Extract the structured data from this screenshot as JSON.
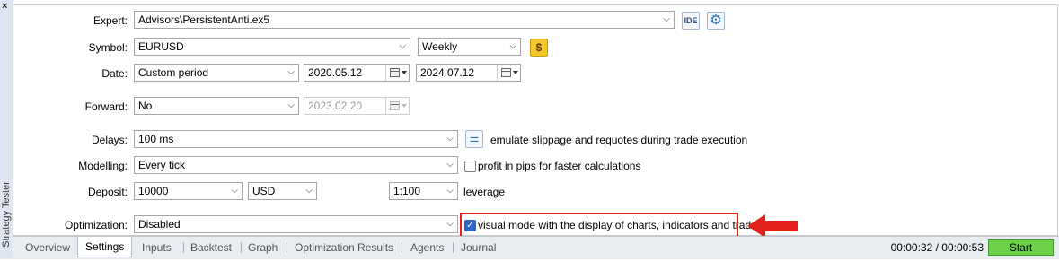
{
  "side_panel": {
    "close": "×",
    "title": "Strategy Tester"
  },
  "expert": {
    "label": "Expert:",
    "value": "Advisors\\PersistentAnti.ex5",
    "ide_label": "IDE",
    "settings_icon": "gear-icon"
  },
  "symbol": {
    "label": "Symbol:",
    "value": "EURUSD",
    "period": "Weekly",
    "symbol_icon": "dollar-icon"
  },
  "date": {
    "label": "Date:",
    "mode": "Custom period",
    "from": "2020.05.12",
    "to": "2024.07.12"
  },
  "forward": {
    "label": "Forward:",
    "mode": "No",
    "date": "2023.02.20"
  },
  "delays": {
    "label": "Delays:",
    "value": "100 ms",
    "note": "emulate slippage and requotes during trade execution"
  },
  "modelling": {
    "label": "Modelling:",
    "value": "Every tick",
    "checkbox_label": "profit in pips for faster calculations",
    "checked": false
  },
  "deposit": {
    "label": "Deposit:",
    "amount": "10000",
    "currency": "USD",
    "leverage": "1:100",
    "leverage_label": "leverage"
  },
  "optimization": {
    "label": "Optimization:",
    "value": "Disabled",
    "visual_label": "visual mode with the display of charts, indicators and trades",
    "visual_checked": true
  },
  "annotation": {
    "highlight_color": "#e3231b"
  },
  "tabs": [
    "Overview",
    "Settings",
    "Inputs",
    "Backtest",
    "Graph",
    "Optimization Results",
    "Agents",
    "Journal"
  ],
  "active_tab": "Settings",
  "status": {
    "timer": "00:00:32 / 00:00:53",
    "start_label": "Start"
  }
}
